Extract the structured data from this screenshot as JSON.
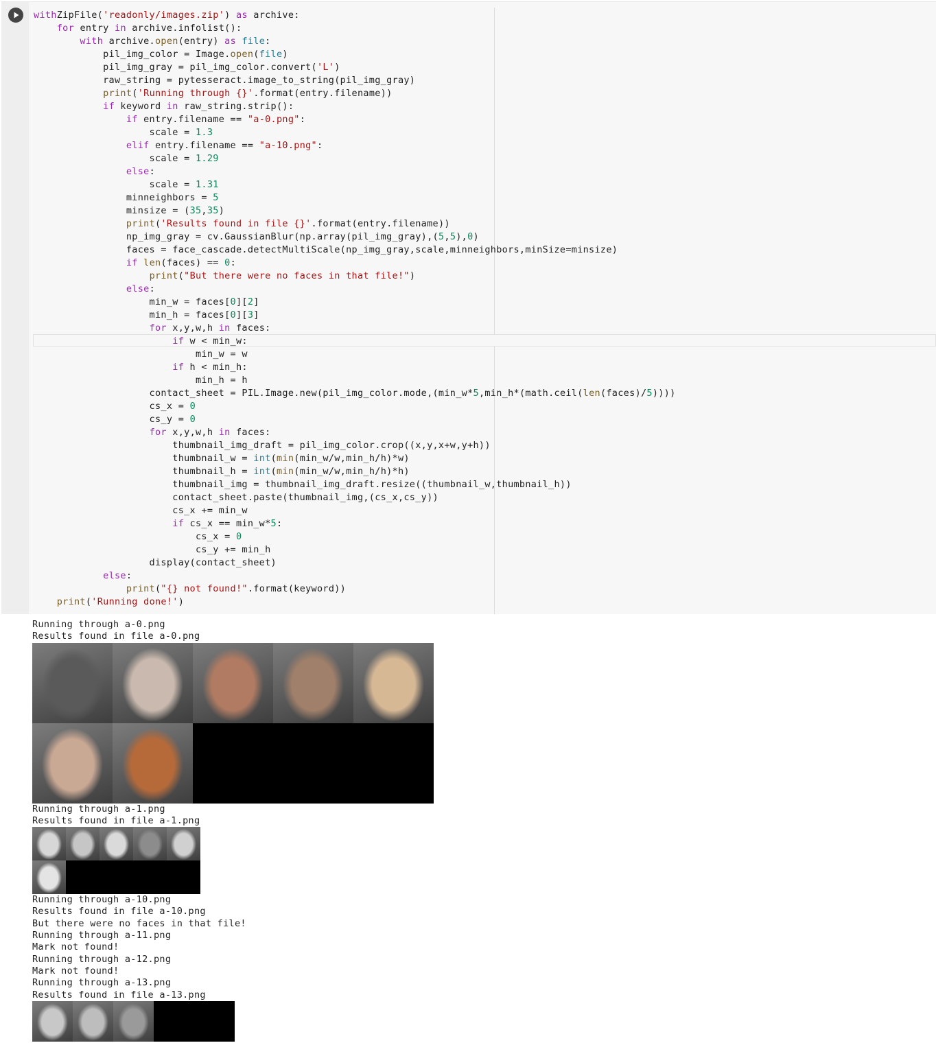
{
  "code_lines": [
    [
      [
        "kw",
        "with"
      ],
      [
        "",
        "ZipFile("
      ],
      [
        "str",
        "'readonly/images.zip'"
      ],
      [
        "",
        ") "
      ],
      [
        "kw",
        "as"
      ],
      [
        "",
        " archive:"
      ]
    ],
    [
      [
        "",
        "    "
      ],
      [
        "kw",
        "for"
      ],
      [
        "",
        " entry "
      ],
      [
        "kw",
        "in"
      ],
      [
        "",
        " archive.infolist():"
      ]
    ],
    [
      [
        "",
        "        "
      ],
      [
        "kw",
        "with"
      ],
      [
        "",
        " archive."
      ],
      [
        "fn",
        "open"
      ],
      [
        "",
        "(entry) "
      ],
      [
        "kw",
        "as"
      ],
      [
        "",
        " "
      ],
      [
        "bi",
        "file"
      ],
      [
        "",
        ":"
      ]
    ],
    [
      [
        "",
        "            pil_img_color = Image."
      ],
      [
        "fn",
        "open"
      ],
      [
        "",
        "("
      ],
      [
        "bi",
        "file"
      ],
      [
        "",
        ")"
      ]
    ],
    [
      [
        "",
        "            pil_img_gray = pil_img_color.convert("
      ],
      [
        "str",
        "'L'"
      ],
      [
        "",
        ")"
      ]
    ],
    [
      [
        "",
        "            raw_string = pytesseract.image_to_string(pil_img_gray)"
      ]
    ],
    [
      [
        "",
        "            "
      ],
      [
        "fn",
        "print"
      ],
      [
        "",
        "("
      ],
      [
        "str",
        "'Running through {}'"
      ],
      [
        "",
        ".format(entry.filename))"
      ]
    ],
    [
      [
        "",
        "            "
      ],
      [
        "kw",
        "if"
      ],
      [
        "",
        " keyword "
      ],
      [
        "kw",
        "in"
      ],
      [
        "",
        " raw_string.strip():"
      ]
    ],
    [
      [
        "",
        "                "
      ],
      [
        "kw",
        "if"
      ],
      [
        "",
        " entry.filename == "
      ],
      [
        "str",
        "\"a-0.png\""
      ],
      [
        "",
        ":"
      ]
    ],
    [
      [
        "",
        "                    scale = "
      ],
      [
        "num",
        "1.3"
      ]
    ],
    [
      [
        "",
        "                "
      ],
      [
        "kw",
        "elif"
      ],
      [
        "",
        " entry.filename == "
      ],
      [
        "str",
        "\"a-10.png\""
      ],
      [
        "",
        ":"
      ]
    ],
    [
      [
        "",
        "                    scale = "
      ],
      [
        "num",
        "1.29"
      ]
    ],
    [
      [
        "",
        "                "
      ],
      [
        "kw",
        "else"
      ],
      [
        "",
        ":"
      ]
    ],
    [
      [
        "",
        "                    scale = "
      ],
      [
        "num",
        "1.31"
      ]
    ],
    [
      [
        "",
        "                minneighbors = "
      ],
      [
        "num",
        "5"
      ]
    ],
    [
      [
        "",
        "                minsize = ("
      ],
      [
        "num",
        "35"
      ],
      [
        "",
        ","
      ],
      [
        "num",
        "35"
      ],
      [
        "",
        ")"
      ]
    ],
    [
      [
        "",
        "                "
      ],
      [
        "fn",
        "print"
      ],
      [
        "",
        "("
      ],
      [
        "str",
        "'Results found in file {}'"
      ],
      [
        "",
        ".format(entry.filename))"
      ]
    ],
    [
      [
        "",
        "                np_img_gray = cv.GaussianBlur(np.array(pil_img_gray),("
      ],
      [
        "num",
        "5"
      ],
      [
        "",
        ","
      ],
      [
        "num",
        "5"
      ],
      [
        "",
        "),"
      ],
      [
        "num",
        "0"
      ],
      [
        "",
        ")"
      ]
    ],
    [
      [
        "",
        "                faces = face_cascade.detectMultiScale(np_img_gray,scale,minneighbors,minSize=minsize)"
      ]
    ],
    [
      [
        "",
        "                "
      ],
      [
        "kw",
        "if"
      ],
      [
        "",
        " "
      ],
      [
        "fn",
        "len"
      ],
      [
        "",
        "(faces) == "
      ],
      [
        "num",
        "0"
      ],
      [
        "",
        ":"
      ]
    ],
    [
      [
        "",
        "                    "
      ],
      [
        "fn",
        "print"
      ],
      [
        "",
        "("
      ],
      [
        "str",
        "\"But there were no faces in that file!\""
      ],
      [
        "",
        ")"
      ]
    ],
    [
      [
        "",
        "                "
      ],
      [
        "kw",
        "else"
      ],
      [
        "",
        ":"
      ]
    ],
    [
      [
        "",
        "                    min_w = faces["
      ],
      [
        "num",
        "0"
      ],
      [
        "",
        "]["
      ],
      [
        "num",
        "2"
      ],
      [
        "",
        "]"
      ]
    ],
    [
      [
        "",
        "                    min_h = faces["
      ],
      [
        "num",
        "0"
      ],
      [
        "",
        "]["
      ],
      [
        "num",
        "3"
      ],
      [
        "",
        "]"
      ]
    ],
    [
      [
        "",
        "                    "
      ],
      [
        "kw",
        "for"
      ],
      [
        "",
        " x,y,w,h "
      ],
      [
        "kw",
        "in"
      ],
      [
        "",
        " faces:"
      ]
    ],
    [
      [
        "",
        "                        "
      ],
      [
        "kw",
        "if"
      ],
      [
        "",
        " w < min_w:"
      ]
    ],
    [
      [
        "",
        "                            min_w = w"
      ]
    ],
    [
      [
        "",
        "                        "
      ],
      [
        "kw",
        "if"
      ],
      [
        "",
        " h < min_h:"
      ]
    ],
    [
      [
        "",
        "                            min_h = h"
      ]
    ],
    [
      [
        "",
        "                    contact_sheet = PIL.Image.new(pil_img_color.mode,(min_w*"
      ],
      [
        "num",
        "5"
      ],
      [
        "",
        ",min_h*(math.ceil("
      ],
      [
        "fn",
        "len"
      ],
      [
        "",
        "(faces)/"
      ],
      [
        "num",
        "5"
      ],
      [
        "",
        "))))"
      ]
    ],
    [
      [
        "",
        "                    cs_x = "
      ],
      [
        "num",
        "0"
      ]
    ],
    [
      [
        "",
        "                    cs_y = "
      ],
      [
        "num",
        "0"
      ]
    ],
    [
      [
        "",
        "                    "
      ],
      [
        "kw",
        "for"
      ],
      [
        "",
        " x,y,w,h "
      ],
      [
        "kw",
        "in"
      ],
      [
        "",
        " faces:"
      ]
    ],
    [
      [
        "",
        "                        thumbnail_img_draft = pil_img_color.crop((x,y,x+w,y+h))"
      ]
    ],
    [
      [
        "",
        "                        thumbnail_w = "
      ],
      [
        "bi",
        "int"
      ],
      [
        "",
        "("
      ],
      [
        "fn",
        "min"
      ],
      [
        "",
        "(min_w/w,min_h/h)*w)"
      ]
    ],
    [
      [
        "",
        "                        thumbnail_h = "
      ],
      [
        "bi",
        "int"
      ],
      [
        "",
        "("
      ],
      [
        "fn",
        "min"
      ],
      [
        "",
        "(min_w/w,min_h/h)*h)"
      ]
    ],
    [
      [
        "",
        "                        thumbnail_img = thumbnail_img_draft.resize((thumbnail_w,thumbnail_h))"
      ]
    ],
    [
      [
        "",
        "                        contact_sheet.paste(thumbnail_img,(cs_x,cs_y))"
      ]
    ],
    [
      [
        "",
        "                        cs_x += min_w"
      ]
    ],
    [
      [
        "",
        "                        "
      ],
      [
        "kw",
        "if"
      ],
      [
        "",
        " cs_x == min_w*"
      ],
      [
        "num",
        "5"
      ],
      [
        "",
        ":"
      ]
    ],
    [
      [
        "",
        "                            cs_x = "
      ],
      [
        "num",
        "0"
      ]
    ],
    [
      [
        "",
        "                            cs_y += min_h"
      ]
    ],
    [
      [
        "",
        "                    display(contact_sheet)"
      ]
    ],
    [
      [
        "",
        "            "
      ],
      [
        "kw",
        "else"
      ],
      [
        "",
        ":"
      ]
    ],
    [
      [
        "",
        "                "
      ],
      [
        "fn",
        "print"
      ],
      [
        "",
        "("
      ],
      [
        "str",
        "\"{} not found!\""
      ],
      [
        "",
        ".format(keyword))"
      ]
    ],
    [
      [
        "",
        "    "
      ],
      [
        "fn",
        "print"
      ],
      [
        "",
        "("
      ],
      [
        "str",
        "'Running done!'"
      ],
      [
        "",
        ")"
      ]
    ]
  ],
  "output_blocks": [
    {
      "type": "text",
      "lines": [
        "Running through a-0.png",
        "Results found in file a-0.png"
      ]
    },
    {
      "type": "sheet",
      "cols": 5,
      "rows": 2,
      "tile": 117,
      "faces": [
        {
          "tone": "#5a5a5a"
        },
        {
          "tone": "#c9b9ae"
        },
        {
          "tone": "#b07b62"
        },
        {
          "tone": "#a0806a"
        },
        {
          "tone": "#d6b895"
        },
        {
          "tone": "#c9a894"
        },
        {
          "tone": "#b66a3a"
        }
      ]
    },
    {
      "type": "text",
      "lines": [
        "Running through a-1.png",
        "Results found in file a-1.png"
      ]
    },
    {
      "type": "sheet",
      "cols": 5,
      "rows": 2,
      "tile": 49,
      "faces": [
        {
          "tone": "#d7d7d7"
        },
        {
          "tone": "#c6c6c6"
        },
        {
          "tone": "#dadada"
        },
        {
          "tone": "#8c8c8c"
        },
        {
          "tone": "#d0d0d0"
        },
        {
          "tone": "#e4e4e4"
        }
      ]
    },
    {
      "type": "text",
      "lines": [
        "Running through a-10.png",
        "Results found in file a-10.png",
        "But there were no faces in that file!",
        "Running through a-11.png",
        "Mark not found!",
        "Running through a-12.png",
        "Mark not found!",
        "Running through a-13.png",
        "Results found in file a-13.png"
      ]
    },
    {
      "type": "sheet",
      "cols": 5,
      "rows": 1,
      "tile": 59,
      "faces": [
        {
          "tone": "#c8c8c8"
        },
        {
          "tone": "#bdbdbd"
        },
        {
          "tone": "#9a9a9a"
        }
      ]
    }
  ]
}
